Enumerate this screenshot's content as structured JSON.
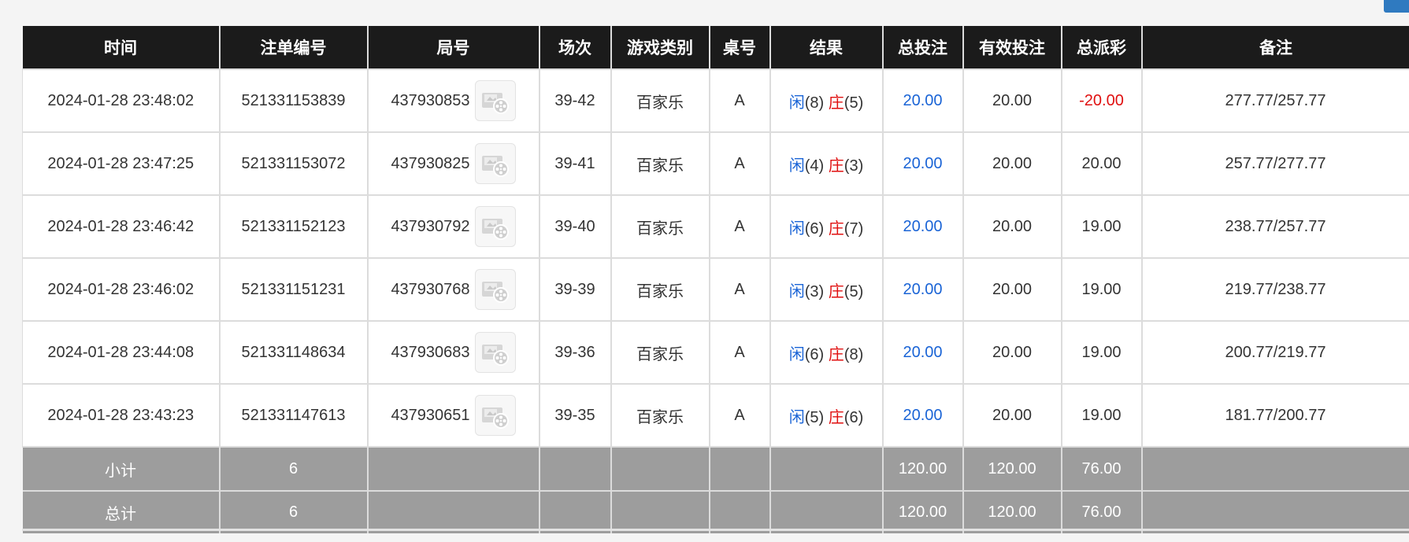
{
  "table": {
    "headers": [
      "时间",
      "注单编号",
      "局号",
      "场次",
      "游戏类别",
      "桌号",
      "结果",
      "总投注",
      "有效投注",
      "总派彩",
      "备注"
    ],
    "rows": [
      {
        "time": "2024-01-28 23:48:02",
        "order_id": "521331153839",
        "round_id": "437930853",
        "shoe": "39-42",
        "game": "百家乐",
        "table": "A",
        "player_label": "闲",
        "player_score": "(8)",
        "banker_label": "庄",
        "banker_score": "(5)",
        "total_bet": "20.00",
        "valid_bet": "20.00",
        "payout": "-20.00",
        "payout_negative": true,
        "note": "277.77/257.77"
      },
      {
        "time": "2024-01-28 23:47:25",
        "order_id": "521331153072",
        "round_id": "437930825",
        "shoe": "39-41",
        "game": "百家乐",
        "table": "A",
        "player_label": "闲",
        "player_score": "(4)",
        "banker_label": "庄",
        "banker_score": "(3)",
        "total_bet": "20.00",
        "valid_bet": "20.00",
        "payout": "20.00",
        "payout_negative": false,
        "note": "257.77/277.77"
      },
      {
        "time": "2024-01-28 23:46:42",
        "order_id": "521331152123",
        "round_id": "437930792",
        "shoe": "39-40",
        "game": "百家乐",
        "table": "A",
        "player_label": "闲",
        "player_score": "(6)",
        "banker_label": "庄",
        "banker_score": "(7)",
        "total_bet": "20.00",
        "valid_bet": "20.00",
        "payout": "19.00",
        "payout_negative": false,
        "note": "238.77/257.77"
      },
      {
        "time": "2024-01-28 23:46:02",
        "order_id": "521331151231",
        "round_id": "437930768",
        "shoe": "39-39",
        "game": "百家乐",
        "table": "A",
        "player_label": "闲",
        "player_score": "(3)",
        "banker_label": "庄",
        "banker_score": "(5)",
        "total_bet": "20.00",
        "valid_bet": "20.00",
        "payout": "19.00",
        "payout_negative": false,
        "note": "219.77/238.77"
      },
      {
        "time": "2024-01-28 23:44:08",
        "order_id": "521331148634",
        "round_id": "437930683",
        "shoe": "39-36",
        "game": "百家乐",
        "table": "A",
        "player_label": "闲",
        "player_score": "(6)",
        "banker_label": "庄",
        "banker_score": "(8)",
        "total_bet": "20.00",
        "valid_bet": "20.00",
        "payout": "19.00",
        "payout_negative": false,
        "note": "200.77/219.77"
      },
      {
        "time": "2024-01-28 23:43:23",
        "order_id": "521331147613",
        "round_id": "437930651",
        "shoe": "39-35",
        "game": "百家乐",
        "table": "A",
        "player_label": "闲",
        "player_score": "(5)",
        "banker_label": "庄",
        "banker_score": "(6)",
        "total_bet": "20.00",
        "valid_bet": "20.00",
        "payout": "19.00",
        "payout_negative": false,
        "note": "181.77/200.77"
      }
    ],
    "subtotal": {
      "label": "小计",
      "count": "6",
      "total_bet": "120.00",
      "valid_bet": "120.00",
      "payout": "76.00"
    },
    "grand_total": {
      "label": "总计",
      "count": "6",
      "total_bet": "120.00",
      "valid_bet": "120.00",
      "payout": "76.00"
    },
    "icons": {
      "video": "video-replay-icon"
    }
  },
  "colors": {
    "header_bg": "#1b1b1b",
    "footer_bg": "#9d9d9d",
    "player_blue": "#1a64d6",
    "banker_red": "#e01010",
    "corner_button": "#2f7ac0"
  }
}
